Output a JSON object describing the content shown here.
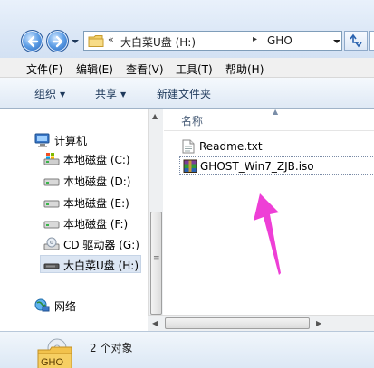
{
  "address_bar": {
    "crumbs": [
      "大白菜U盘 (H:)",
      "GHO"
    ],
    "overflow_glyph": "«",
    "separator_glyph": "▸"
  },
  "menu": [
    "文件(F)",
    "编辑(E)",
    "查看(V)",
    "工具(T)",
    "帮助(H)"
  ],
  "toolbar": {
    "organize": "组织",
    "share": "共享",
    "new_folder": "新建文件夹"
  },
  "nav_tree": [
    {
      "label": "计算机",
      "icon": "computer-icon"
    },
    {
      "label": "本地磁盘 (C:)",
      "icon": "system-drive-icon"
    },
    {
      "label": "本地磁盘 (D:)",
      "icon": "drive-icon"
    },
    {
      "label": "本地磁盘 (E:)",
      "icon": "drive-icon"
    },
    {
      "label": "本地磁盘 (F:)",
      "icon": "drive-icon"
    },
    {
      "label": "CD 驱动器 (G:)",
      "icon": "cd-drive-icon"
    },
    {
      "label": "大白菜U盘 (H:)",
      "icon": "usb-drive-icon",
      "selected": true
    },
    {
      "label": "网络",
      "icon": "network-icon"
    }
  ],
  "column_header": "名称",
  "files": [
    {
      "name": "Readme.txt",
      "icon": "text-file-icon"
    },
    {
      "name": "GHOST_Win7_ZJB.iso",
      "icon": "winrar-archive-icon",
      "focused": true
    }
  ],
  "details": {
    "count_text": "2 个对象",
    "icon_label": "GHO"
  },
  "colors": {
    "annotation_arrow": "#ee3fd6",
    "selection": "#dce6f3",
    "toolbar_text": "#1e395b"
  }
}
